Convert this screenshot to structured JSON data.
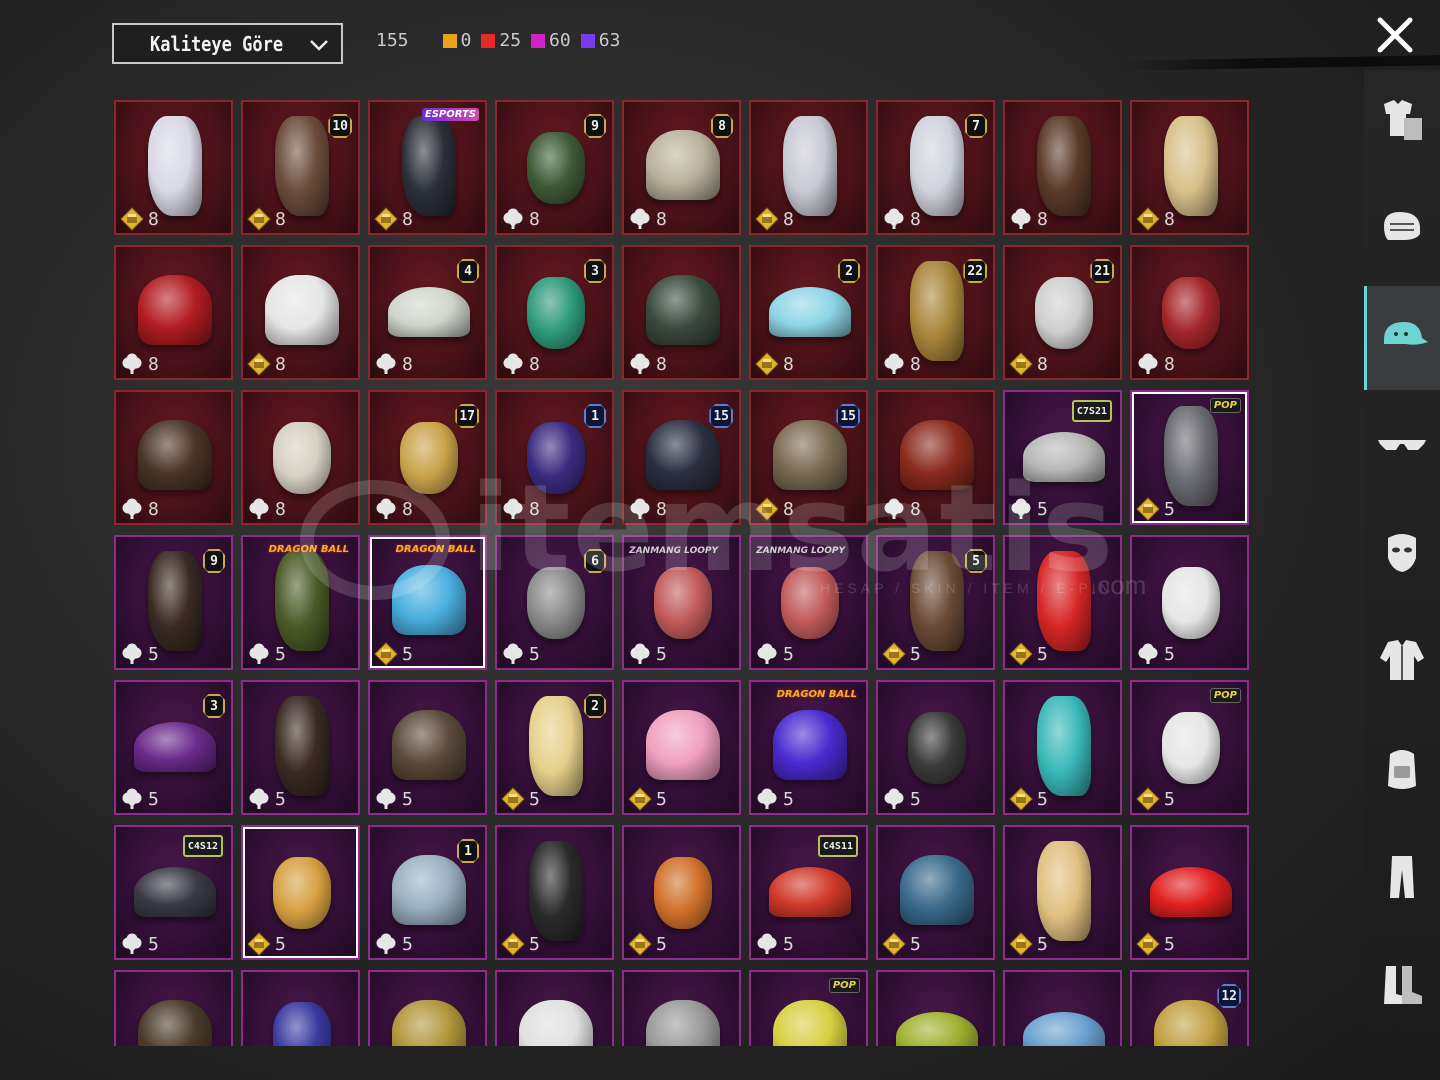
{
  "sort": {
    "label": "Kaliteye Göre"
  },
  "counts": {
    "total": "155",
    "by_quality": [
      {
        "value": "0",
        "color": "#e8a319"
      },
      {
        "value": "25",
        "color": "#e52a2a"
      },
      {
        "value": "60",
        "color": "#d321c9"
      },
      {
        "value": "63",
        "color": "#7a3cf0"
      }
    ]
  },
  "watermark": {
    "brand": "itemsatis",
    "tagline": "HESAP / SKIN / ITEM / E-PIN",
    "domain": ".com"
  },
  "sidebar": {
    "items": [
      {
        "name": "outfit-set",
        "label": "outfit-set-icon"
      },
      {
        "name": "face",
        "label": "face-icon"
      },
      {
        "name": "headwear",
        "label": "cap-icon",
        "active": true
      },
      {
        "name": "eyewear",
        "label": "glasses-icon"
      },
      {
        "name": "mask",
        "label": "mask-icon"
      },
      {
        "name": "top",
        "label": "jacket-icon"
      },
      {
        "name": "backpack",
        "label": "backpack-icon"
      },
      {
        "name": "pants",
        "label": "pants-icon"
      },
      {
        "name": "shoes",
        "label": "boots-icon"
      }
    ]
  },
  "items": [
    {
      "r": "red",
      "badge": "",
      "tag": "",
      "val": "8",
      "cur": "gold",
      "c": "#d9d9e6",
      "shape": "long"
    },
    {
      "r": "red",
      "badge": "10",
      "tag": "",
      "val": "8",
      "cur": "gold",
      "c": "#6b4c3a",
      "shape": "long"
    },
    {
      "r": "red",
      "badge": "",
      "tag": "ESPORTS",
      "tagk": "esports",
      "val": "8",
      "cur": "gold",
      "c": "#2b2f38",
      "shape": "long"
    },
    {
      "r": "red",
      "badge": "9",
      "tag": "",
      "val": "8",
      "cur": "silver",
      "c": "#3d5a36",
      "shape": "mask"
    },
    {
      "r": "red",
      "badge": "8",
      "tag": "",
      "val": "8",
      "cur": "silver",
      "c": "#b9b29c",
      "shape": "helmet"
    },
    {
      "r": "red",
      "badge": "",
      "tag": "",
      "val": "8",
      "cur": "gold",
      "c": "#c9c9d4",
      "shape": "long"
    },
    {
      "r": "red",
      "badge": "7",
      "tag": "",
      "val": "8",
      "cur": "silver",
      "c": "#cfd3dc",
      "shape": "long"
    },
    {
      "r": "red",
      "badge": "",
      "tag": "",
      "val": "8",
      "cur": "silver",
      "c": "#5a3a28",
      "shape": "long"
    },
    {
      "r": "red",
      "badge": "",
      "tag": "",
      "val": "8",
      "cur": "gold",
      "c": "#d8c08a",
      "shape": "long"
    },
    {
      "r": "red",
      "badge": "",
      "tag": "",
      "val": "8",
      "cur": "silver",
      "c": "#b01c22",
      "shape": "helmet"
    },
    {
      "r": "red",
      "badge": "",
      "tag": "",
      "val": "8",
      "cur": "gold",
      "c": "#e6e6e6",
      "shape": "helmet"
    },
    {
      "r": "red",
      "badge": "4",
      "tag": "",
      "val": "8",
      "cur": "silver",
      "c": "#d0d6cc",
      "shape": "hat"
    },
    {
      "r": "red",
      "badge": "3",
      "tag": "",
      "val": "8",
      "cur": "silver",
      "c": "#2e9a7a",
      "shape": "mask"
    },
    {
      "r": "red",
      "badge": "",
      "tag": "",
      "val": "8",
      "cur": "silver",
      "c": "#3a4a3e",
      "shape": "helmet"
    },
    {
      "r": "red",
      "badge": "2",
      "tag": "",
      "val": "8",
      "cur": "gold",
      "c": "#8fd6e6",
      "shape": "hat"
    },
    {
      "r": "red",
      "badge": "22",
      "tag": "",
      "val": "8",
      "cur": "silver",
      "c": "#a8853a",
      "shape": "long"
    },
    {
      "r": "red",
      "badge": "21",
      "tag": "",
      "val": "8",
      "cur": "gold",
      "c": "#cfcfcf",
      "shape": "mask"
    },
    {
      "r": "red",
      "badge": "",
      "tag": "",
      "val": "8",
      "cur": "silver",
      "c": "#a3262a",
      "shape": "mask"
    },
    {
      "r": "red",
      "badge": "",
      "tag": "",
      "val": "8",
      "cur": "silver",
      "c": "#4a3426",
      "shape": "helmet"
    },
    {
      "r": "red",
      "badge": "",
      "tag": "",
      "val": "8",
      "cur": "silver",
      "c": "#d6d0c2",
      "shape": "mask"
    },
    {
      "r": "red",
      "badge": "17",
      "tag": "",
      "val": "8",
      "cur": "silver",
      "c": "#c9a24a",
      "shape": "mask"
    },
    {
      "r": "red",
      "badge": "1",
      "badgek": "blue",
      "tag": "",
      "val": "8",
      "cur": "silver",
      "c": "#3a2a80",
      "shape": "mask"
    },
    {
      "r": "red",
      "badge": "15",
      "badgek": "blue",
      "tag": "",
      "val": "8",
      "cur": "silver",
      "c": "#2a3040",
      "shape": "helmet"
    },
    {
      "r": "red",
      "badge": "15",
      "badgek": "blue",
      "tag": "",
      "val": "8",
      "cur": "gold",
      "c": "#7a6a52",
      "shape": "helmet"
    },
    {
      "r": "red",
      "badge": "",
      "tag": "",
      "val": "8",
      "cur": "silver",
      "c": "#8a2a1e",
      "shape": "helmet"
    },
    {
      "r": "purple",
      "badge": "C7S21",
      "badgek": "season",
      "tag": "",
      "val": "5",
      "cur": "silver",
      "c": "#b8b8b8",
      "shape": "hat"
    },
    {
      "r": "purple",
      "badge": "",
      "tag": "POP",
      "tagk": "pop",
      "val": "5",
      "cur": "gold",
      "c": "#6a6a72",
      "shape": "long",
      "sel": true
    },
    {
      "r": "purple",
      "badge": "9",
      "tag": "",
      "val": "5",
      "cur": "silver",
      "c": "#3a2a22",
      "shape": "long"
    },
    {
      "r": "purple",
      "badge": "",
      "tag": "DRAGON BALL",
      "tagk": "dragon",
      "val": "5",
      "cur": "silver",
      "c": "#4a5a26",
      "shape": "long"
    },
    {
      "r": "purple",
      "badge": "",
      "tag": "DRAGON BALL",
      "tagk": "dragon",
      "val": "5",
      "cur": "gold",
      "c": "#4ab0e0",
      "shape": "helmet",
      "sel": true
    },
    {
      "r": "purple",
      "badge": "6",
      "tag": "",
      "val": "5",
      "cur": "silver",
      "c": "#8a8a8a",
      "shape": "mask"
    },
    {
      "r": "purple",
      "badge": "",
      "tag": "ZANMANG LOOPY",
      "tagk": "loopy",
      "val": "5",
      "cur": "silver",
      "c": "#c05a5a",
      "shape": "mask"
    },
    {
      "r": "purple",
      "badge": "",
      "tag": "ZANMANG LOOPY",
      "tagk": "loopy",
      "val": "5",
      "cur": "silver",
      "c": "#c05a5a",
      "shape": "mask"
    },
    {
      "r": "purple",
      "badge": "5",
      "tag": "",
      "val": "5",
      "cur": "gold",
      "c": "#6a4a36",
      "shape": "long"
    },
    {
      "r": "purple",
      "badge": "",
      "tag": "",
      "val": "5",
      "cur": "gold",
      "c": "#d62626",
      "shape": "long"
    },
    {
      "r": "purple",
      "badge": "",
      "tag": "",
      "val": "5",
      "cur": "silver",
      "c": "#e6e6e6",
      "shape": "mask"
    },
    {
      "r": "purple",
      "badge": "3",
      "tag": "",
      "val": "5",
      "cur": "silver",
      "c": "#6a2a8a",
      "shape": "hat"
    },
    {
      "r": "purple",
      "badge": "",
      "tag": "",
      "val": "5",
      "cur": "silver",
      "c": "#3a2a22",
      "shape": "long"
    },
    {
      "r": "purple",
      "badge": "",
      "tag": "",
      "val": "5",
      "cur": "silver",
      "c": "#5a4a3a",
      "shape": "helmet"
    },
    {
      "r": "purple",
      "badge": "2",
      "tag": "",
      "val": "5",
      "cur": "gold",
      "c": "#e6d08a",
      "shape": "long"
    },
    {
      "r": "purple",
      "badge": "",
      "tag": "",
      "val": "5",
      "cur": "gold",
      "c": "#f0a0c0",
      "shape": "helmet"
    },
    {
      "r": "purple",
      "badge": "",
      "tag": "DRAGON BALL",
      "tagk": "dragon",
      "val": "5",
      "cur": "silver",
      "c": "#4a2ad0",
      "shape": "helmet"
    },
    {
      "r": "purple",
      "badge": "",
      "tag": "",
      "val": "5",
      "cur": "silver",
      "c": "#3a3a3a",
      "shape": "mask"
    },
    {
      "r": "purple",
      "badge": "",
      "tag": "",
      "val": "5",
      "cur": "gold",
      "c": "#3ab8b8",
      "shape": "long"
    },
    {
      "r": "purple",
      "badge": "",
      "tag": "POP",
      "tagk": "pop",
      "val": "5",
      "cur": "gold",
      "c": "#e6e6e6",
      "shape": "mask"
    },
    {
      "r": "purple",
      "badge": "C4S12",
      "badgek": "season",
      "tag": "",
      "val": "5",
      "cur": "silver",
      "c": "#3a3a46",
      "shape": "hat"
    },
    {
      "r": "purple",
      "badge": "",
      "tag": "",
      "val": "5",
      "cur": "gold",
      "c": "#d6a040",
      "shape": "mask",
      "sel": true
    },
    {
      "r": "purple",
      "badge": "1",
      "tag": "",
      "val": "5",
      "cur": "silver",
      "c": "#9ab0c0",
      "shape": "helmet"
    },
    {
      "r": "purple",
      "badge": "",
      "tag": "",
      "val": "5",
      "cur": "gold",
      "c": "#2a2a2a",
      "shape": "long"
    },
    {
      "r": "purple",
      "badge": "",
      "tag": "",
      "val": "5",
      "cur": "gold",
      "c": "#d0702a",
      "shape": "mask"
    },
    {
      "r": "purple",
      "badge": "C4S11",
      "badgek": "season",
      "tag": "",
      "val": "5",
      "cur": "silver",
      "c": "#d03a2a",
      "shape": "hat"
    },
    {
      "r": "purple",
      "badge": "",
      "tag": "",
      "val": "5",
      "cur": "gold",
      "c": "#3a6a8a",
      "shape": "helmet"
    },
    {
      "r": "purple",
      "badge": "",
      "tag": "",
      "val": "5",
      "cur": "gold",
      "c": "#e0c080",
      "shape": "long"
    },
    {
      "r": "purple",
      "badge": "",
      "tag": "",
      "val": "5",
      "cur": "gold",
      "c": "#e02020",
      "shape": "hat"
    },
    {
      "r": "purple",
      "badge": "",
      "tag": "",
      "val": "",
      "cur": "",
      "c": "#4a3a2a",
      "shape": "helmet"
    },
    {
      "r": "purple",
      "badge": "",
      "tag": "",
      "val": "",
      "cur": "",
      "c": "#3a3aa0",
      "shape": "mask"
    },
    {
      "r": "purple",
      "badge": "",
      "tag": "",
      "val": "",
      "cur": "",
      "c": "#b0963a",
      "shape": "helmet"
    },
    {
      "r": "purple",
      "badge": "",
      "tag": "",
      "val": "",
      "cur": "",
      "c": "#e0e0e0",
      "shape": "helmet"
    },
    {
      "r": "purple",
      "badge": "",
      "tag": "",
      "val": "",
      "cur": "",
      "c": "#9a9a9a",
      "shape": "helmet"
    },
    {
      "r": "purple",
      "badge": "",
      "tag": "POP",
      "tagk": "pop",
      "val": "",
      "cur": "",
      "c": "#d6d040",
      "shape": "helmet"
    },
    {
      "r": "purple",
      "badge": "",
      "tag": "",
      "val": "",
      "cur": "",
      "c": "#a0b030",
      "shape": "hat"
    },
    {
      "r": "purple",
      "badge": "",
      "tag": "",
      "val": "",
      "cur": "",
      "c": "#6aa0d0",
      "shape": "hat"
    },
    {
      "r": "purple",
      "badge": "12",
      "badgek": "blue",
      "tag": "",
      "val": "",
      "cur": "",
      "c": "#c0a040",
      "shape": "helmet"
    }
  ]
}
